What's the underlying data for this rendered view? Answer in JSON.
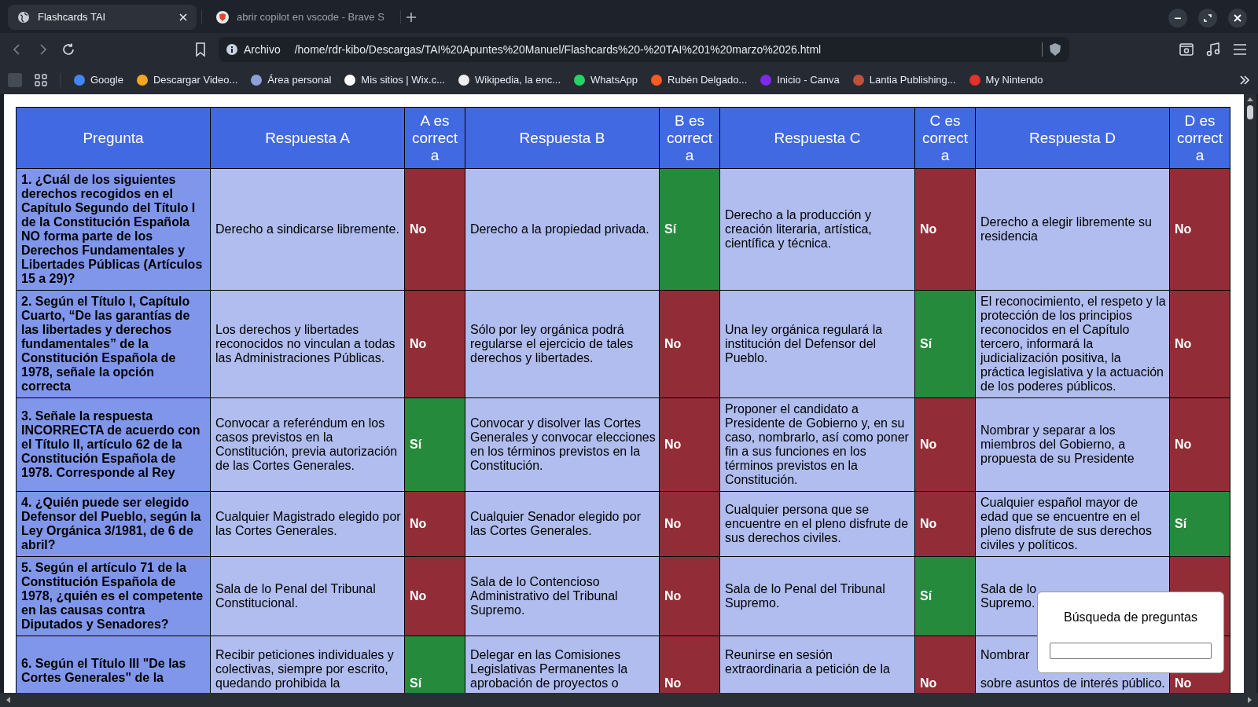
{
  "browser": {
    "tabs": [
      {
        "title": "Flashcards TAI",
        "selected": true,
        "kind": "globe"
      },
      {
        "title": "abrir copilot en vscode - Brave S",
        "selected": false,
        "kind": "brave"
      }
    ],
    "address": {
      "label": "Archivo",
      "url": "/home/rdr-kibo/Descargas/TAI%20Apuntes%20Manuel/Flashcards%20-%20TAI%201%20marzo%2026.html"
    },
    "bookmarks": [
      {
        "label": "Google",
        "color": "#4285f4"
      },
      {
        "label": "Descargar Video...",
        "color": "#f5a623"
      },
      {
        "label": "Área personal",
        "color": "#8ea0d8"
      },
      {
        "label": "Mis sitios | Wix.c...",
        "color": "#ffffff"
      },
      {
        "label": "Wikipedia, la enc...",
        "color": "#eeeeee"
      },
      {
        "label": "WhatsApp",
        "color": "#25d366"
      },
      {
        "label": "Rubén Delgado...",
        "color": "#ff5a1f"
      },
      {
        "label": "Inicio - Canva",
        "color": "#7d2ae8"
      },
      {
        "label": "Lantia Publishing...",
        "color": "#c0503a"
      },
      {
        "label": "My Nintendo",
        "color": "#e4312b"
      }
    ]
  },
  "table": {
    "columns": [
      "Pregunta",
      "Respuesta A",
      "A es correcta",
      "Respuesta B",
      "B es correcta",
      "Respuesta C",
      "C es correcta",
      "Respuesta D",
      "D es correcta"
    ],
    "rows": [
      {
        "question": "1. ¿Cuál de los siguientes derechos recogidos en el Capítulo Segundo del Título I de la Constitución Española NO forma parte de los Derechos Fundamentales y Libertades Públicas (Artículos 15 a 29)?",
        "answers": [
          {
            "text": "Derecho a sindicarse libremente.",
            "verdict": "No",
            "correct": false
          },
          {
            "text": "Derecho a la propiedad privada.",
            "verdict": "Sí",
            "correct": true
          },
          {
            "text": "Derecho a la producción y creación literaria, artística, científica y técnica.",
            "verdict": "No",
            "correct": false
          },
          {
            "text": "Derecho a elegir libremente su residencia",
            "verdict": "No",
            "correct": false
          }
        ]
      },
      {
        "question": "2. Según el Título I, Capítulo Cuarto, “De las garantías de las libertades y derechos fundamentales” de la Constitución Española de 1978, señale la opción correcta",
        "answers": [
          {
            "text": "Los derechos y libertades reconocidos no vinculan a todas las Administraciones Públicas.",
            "verdict": "No",
            "correct": false
          },
          {
            "text": "Sólo por ley orgánica podrá regularse el ejercicio de tales derechos y libertades.",
            "verdict": "No",
            "correct": false
          },
          {
            "text": "Una ley orgánica regulará la institución del Defensor del Pueblo.",
            "verdict": "Sí",
            "correct": true
          },
          {
            "text": "El reconocimiento, el respeto y la protección de los principios reconocidos en el Capítulo tercero, informará la judicialización positiva, la práctica legislativa y la actuación de los poderes públicos.",
            "verdict": "No",
            "correct": false
          }
        ]
      },
      {
        "question": "3. Señale la respuesta INCORRECTA de acuerdo con el Título II, artículo 62 de la Constitución Española de 1978. Corresponde al Rey",
        "answers": [
          {
            "text": "Convocar a referéndum en los casos previstos en la Constitución, previa autorización de las Cortes Generales.",
            "verdict": "Sí",
            "correct": true
          },
          {
            "text": "Convocar y disolver las Cortes Generales y convocar elecciones en los términos previstos en la Constitución.",
            "verdict": "No",
            "correct": false
          },
          {
            "text": "Proponer el candidato a Presidente de Gobierno y, en su caso, nombrarlo, así como poner fin a sus funciones en los términos previstos en la Constitución.",
            "verdict": "No",
            "correct": false
          },
          {
            "text": "Nombrar y separar a los miembros del Gobierno, a propuesta de su Presidente",
            "verdict": "No",
            "correct": false
          }
        ]
      },
      {
        "question": "4. ¿Quién puede ser elegido Defensor del Pueblo, según la Ley Orgánica 3/1981, de 6 de abril?",
        "answers": [
          {
            "text": "Cualquier Magistrado elegido por las Cortes Generales.",
            "verdict": "No",
            "correct": false
          },
          {
            "text": "Cualquier Senador elegido por las Cortes Generales.",
            "verdict": "No",
            "correct": false
          },
          {
            "text": "Cualquier persona que se encuentre en el pleno disfrute de sus derechos civiles.",
            "verdict": "No",
            "correct": false
          },
          {
            "text": "Cualquier español mayor de edad que se encuentre en el pleno disfrute de sus derechos civiles y políticos.",
            "verdict": "Sí",
            "correct": true
          }
        ]
      },
      {
        "question": "5. Según el artículo 71 de la Constitución Española de 1978, ¿quién es el competente en las causas contra Diputados y Senadores?",
        "answers": [
          {
            "text": "Sala de lo Penal del Tribunal Constitucional.",
            "verdict": "No",
            "correct": false
          },
          {
            "text": "Sala de lo Contencioso Administrativo del Tribunal Supremo.",
            "verdict": "No",
            "correct": false
          },
          {
            "text": "Sala de lo Penal del Tribunal Supremo.",
            "verdict": "Sí",
            "correct": true
          },
          {
            "text": "Sala de lo\nSupremo.",
            "correct": false
          }
        ]
      },
      {
        "question": "6. Según el Título III \"De las Cortes Generales\" de la",
        "answers": [
          {
            "text": "Recibir peticiones individuales y colectivas, siempre por escrito, quedando prohibida la",
            "verdict": "Sí",
            "correct": true
          },
          {
            "text": "Delegar en las Comisiones Legislativas Permanentes la aprobación de proyectos o",
            "verdict": "No",
            "correct": false
          },
          {
            "text": "Reunirse en sesión extraordinaria a petición de la",
            "verdict": "No",
            "correct": false
          },
          {
            "text": "Nombrar\n\nsobre asuntos de interés público.",
            "verdict": "No",
            "correct": false
          }
        ]
      }
    ]
  },
  "search_panel": {
    "title": "Búsqueda de preguntas"
  }
}
